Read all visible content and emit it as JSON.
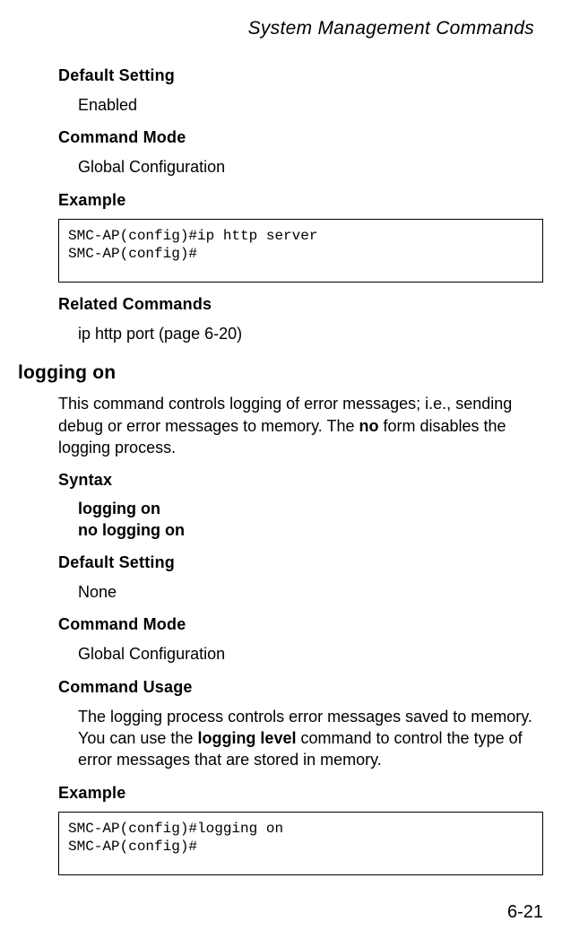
{
  "header": {
    "title": "System Management Commands"
  },
  "section1": {
    "defaultSettingLabel": "Default Setting",
    "defaultSettingValue": "Enabled",
    "commandModeLabel": "Command Mode",
    "commandModeValue": "Global Configuration",
    "exampleLabel": "Example",
    "exampleCode": "SMC-AP(config)#ip http server\nSMC-AP(config)#",
    "relatedCommandsLabel": "Related Commands",
    "relatedCommandsValue": "ip http port (page 6-20)"
  },
  "command": {
    "title": "logging on",
    "descPre": "This command controls logging of error messages; i.e., sending debug or error messages to memory. The ",
    "descBold": "no",
    "descPost": " form disables the logging process.",
    "syntaxLabel": "Syntax",
    "syntaxLine1": "logging on",
    "syntaxLine2": "no logging on",
    "defaultSettingLabel": "Default Setting",
    "defaultSettingValue": "None",
    "commandModeLabel": "Command Mode",
    "commandModeValue": "Global Configuration",
    "commandUsageLabel": "Command Usage",
    "usagePre": "The logging process controls error messages saved to memory. You can use the ",
    "usageBold": "logging level",
    "usagePost": " command to control the type of error messages that are stored in memory.",
    "exampleLabel": "Example",
    "exampleCode": "SMC-AP(config)#logging on\nSMC-AP(config)#"
  },
  "footer": {
    "pageNumber": "6-21"
  }
}
